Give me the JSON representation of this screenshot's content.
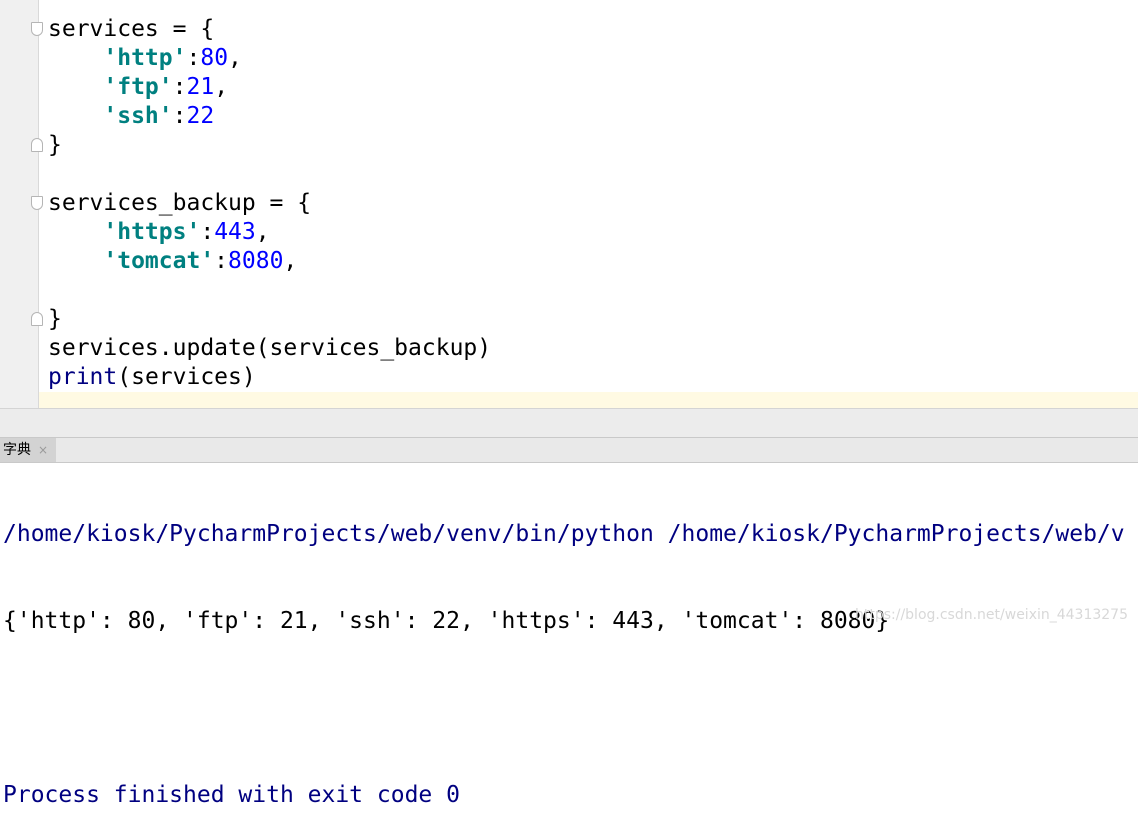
{
  "editor": {
    "lines": [
      {
        "tokens": [
          {
            "t": "plain",
            "v": "services = {"
          }
        ]
      },
      {
        "tokens": [
          {
            "t": "plain",
            "v": "    "
          },
          {
            "t": "str",
            "v": "'http'"
          },
          {
            "t": "plain",
            "v": ":"
          },
          {
            "t": "num",
            "v": "80"
          },
          {
            "t": "plain",
            "v": ","
          }
        ]
      },
      {
        "tokens": [
          {
            "t": "plain",
            "v": "    "
          },
          {
            "t": "str",
            "v": "'ftp'"
          },
          {
            "t": "plain",
            "v": ":"
          },
          {
            "t": "num",
            "v": "21"
          },
          {
            "t": "plain",
            "v": ","
          }
        ]
      },
      {
        "tokens": [
          {
            "t": "plain",
            "v": "    "
          },
          {
            "t": "str",
            "v": "'ssh'"
          },
          {
            "t": "plain",
            "v": ":"
          },
          {
            "t": "num",
            "v": "22"
          }
        ]
      },
      {
        "tokens": [
          {
            "t": "plain",
            "v": "}"
          }
        ]
      },
      {
        "tokens": [
          {
            "t": "plain",
            "v": ""
          }
        ]
      },
      {
        "tokens": [
          {
            "t": "plain",
            "v": "services_backup = {"
          }
        ]
      },
      {
        "tokens": [
          {
            "t": "plain",
            "v": "    "
          },
          {
            "t": "str",
            "v": "'https'"
          },
          {
            "t": "plain",
            "v": ":"
          },
          {
            "t": "num",
            "v": "443"
          },
          {
            "t": "plain",
            "v": ","
          }
        ]
      },
      {
        "tokens": [
          {
            "t": "plain",
            "v": "    "
          },
          {
            "t": "str",
            "v": "'tomcat'"
          },
          {
            "t": "plain",
            "v": ":"
          },
          {
            "t": "num",
            "v": "8080"
          },
          {
            "t": "plain",
            "v": ","
          }
        ]
      },
      {
        "tokens": [
          {
            "t": "plain",
            "v": ""
          }
        ]
      },
      {
        "tokens": [
          {
            "t": "plain",
            "v": "}"
          }
        ]
      },
      {
        "tokens": [
          {
            "t": "plain",
            "v": "services.update(services_backup)"
          }
        ]
      },
      {
        "tokens": [
          {
            "t": "builtin",
            "v": "print"
          },
          {
            "t": "plain",
            "v": "(services)"
          }
        ]
      }
    ]
  },
  "run_tab": {
    "label": "字典",
    "close_glyph": "×"
  },
  "console": {
    "command": "/home/kiosk/PycharmProjects/web/venv/bin/python /home/kiosk/PycharmProjects/web/v",
    "output": "{'http': 80, 'ftp': 21, 'ssh': 22, 'https': 443, 'tomcat': 8080}",
    "blank": "",
    "exit_message": "Process finished with exit code 0"
  },
  "watermark": "https://blog.csdn.net/weixin_44313275",
  "colors": {
    "string": "#008080",
    "number": "#0000ff",
    "builtin": "#000080",
    "console_path": "#000080",
    "caret_line": "#fffae3"
  }
}
